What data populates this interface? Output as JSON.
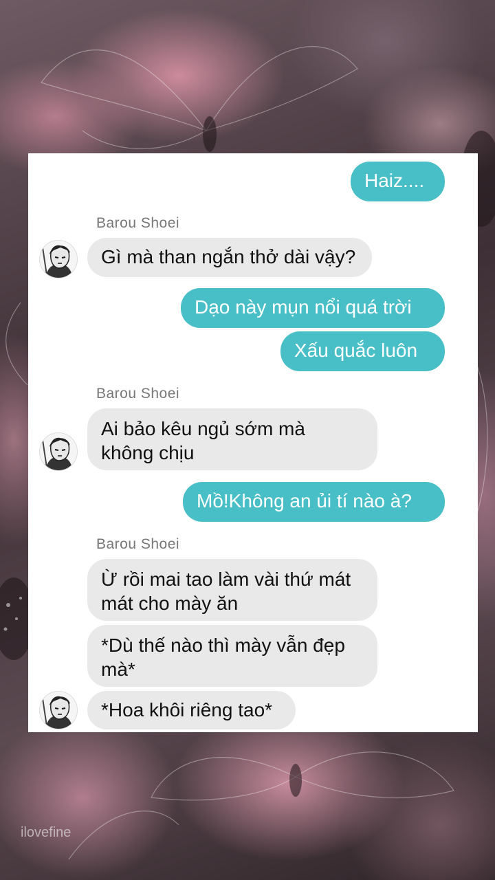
{
  "chat": {
    "messages": [
      {
        "id": "m1",
        "side": "outgoing",
        "text": "Haiz...."
      },
      {
        "id": "m2",
        "side": "incoming",
        "sender": "Barou Shoei",
        "text": "Gì mà than ngắn thở dài vậy?"
      },
      {
        "id": "m3",
        "side": "outgoing",
        "text": "Dạo này mụn nổi quá trời"
      },
      {
        "id": "m4",
        "side": "outgoing",
        "text": "Xấu quắc luôn"
      },
      {
        "id": "m5",
        "side": "incoming",
        "sender": "Barou Shoei",
        "text": "Ai bảo kêu ngủ sớm mà\nkhông chịu"
      },
      {
        "id": "m6",
        "side": "outgoing",
        "text": "Mồ!Không an ủi tí nào à?"
      },
      {
        "id": "m7",
        "side": "incoming",
        "sender": "Barou Shoei",
        "text": "Ừ rồi mai tao làm vài thứ mát\nmát cho mày ăn"
      },
      {
        "id": "m8",
        "side": "incoming",
        "text": "*Dù thế nào thì mày vẫn đẹp\nmà*"
      },
      {
        "id": "m9",
        "side": "incoming",
        "text": "*Hoa khôi riêng tao*"
      }
    ]
  },
  "watermark": "ilovefine",
  "colors": {
    "outgoing_bubble": "#48bfc7",
    "incoming_bubble": "#e9e9ea",
    "panel": "#ffffff",
    "sender_name": "#777777"
  },
  "icons": {
    "avatar": "manga-character-avatar-icon"
  }
}
